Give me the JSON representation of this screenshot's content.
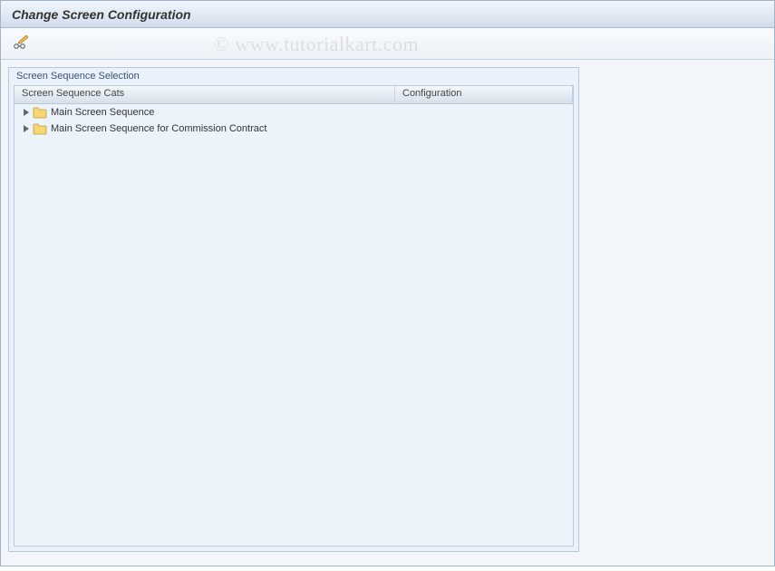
{
  "window": {
    "title": "Change Screen Configuration"
  },
  "panel": {
    "title": "Screen Sequence Selection"
  },
  "tree": {
    "columns": {
      "col1": "Screen Sequence Cats",
      "col2": "Configuration"
    },
    "items": [
      {
        "label": "Main Screen Sequence"
      },
      {
        "label": "Main Screen Sequence for Commission Contract"
      }
    ]
  },
  "watermark": "© www.tutorialkart.com"
}
